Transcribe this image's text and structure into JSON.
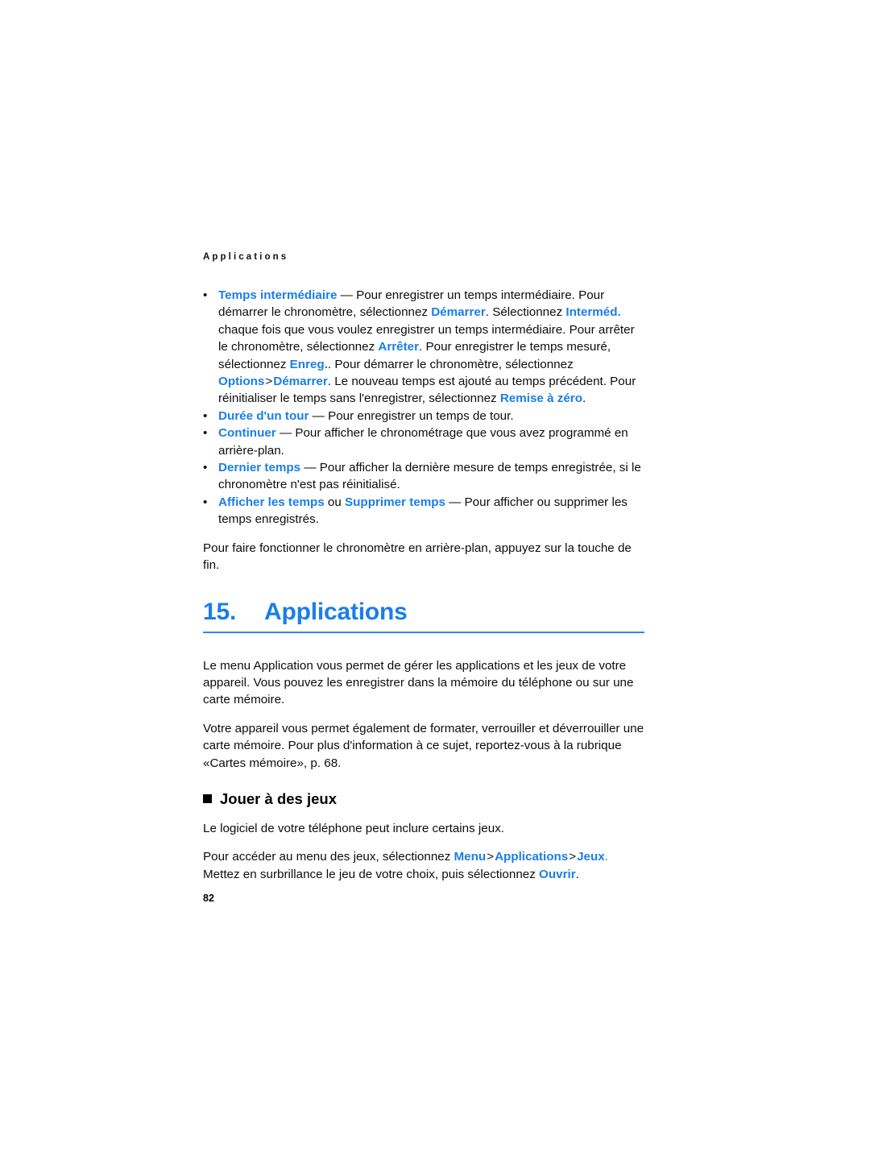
{
  "document": {
    "running_header": "Applications",
    "page_number": "82",
    "accent_color": "#1a7ee8",
    "text_color": "#0d0d0d",
    "background_color": "#ffffff"
  },
  "stopwatch_options": {
    "bullet_glyph": "•",
    "items": [
      {
        "id": "temps-intermediaire",
        "segments": [
          {
            "text": "Temps intermédiaire",
            "style": "blue"
          },
          {
            "text": " — Pour enregistrer un temps intermédiaire. Pour démarrer le chronomètre, sélectionnez ",
            "style": "plain"
          },
          {
            "text": "Démarrer",
            "style": "blue"
          },
          {
            "text": ". Sélectionnez ",
            "style": "plain"
          },
          {
            "text": "Interméd.",
            "style": "blue"
          },
          {
            "text": " chaque fois que vous voulez enregistrer un temps intermédiaire. Pour arrêter le chronomètre, sélectionnez ",
            "style": "plain"
          },
          {
            "text": "Arrêter",
            "style": "blue"
          },
          {
            "text": ". Pour enregistrer le temps mesuré, sélectionnez ",
            "style": "plain"
          },
          {
            "text": "Enreg.",
            "style": "blue"
          },
          {
            "text": ". Pour démarrer le chronomètre, sélectionnez ",
            "style": "plain"
          },
          {
            "text": "Options",
            "style": "blue"
          },
          {
            "text": ">",
            "style": "sep"
          },
          {
            "text": "Démarrer",
            "style": "blue"
          },
          {
            "text": ". Le nouveau temps est ajouté au temps précédent. Pour réinitialiser le temps sans l'enregistrer, sélectionnez ",
            "style": "plain"
          },
          {
            "text": "Remise à zéro",
            "style": "blue"
          },
          {
            "text": ".",
            "style": "plain"
          }
        ]
      },
      {
        "id": "duree-dun-tour",
        "segments": [
          {
            "text": "Durée d'un tour",
            "style": "blue"
          },
          {
            "text": " — Pour enregistrer un temps de tour.",
            "style": "plain"
          }
        ]
      },
      {
        "id": "continuer",
        "segments": [
          {
            "text": "Continuer",
            "style": "blue"
          },
          {
            "text": " — Pour afficher le chronométrage que vous avez programmé en arrière-plan.",
            "style": "plain"
          }
        ]
      },
      {
        "id": "dernier-temps",
        "segments": [
          {
            "text": "Dernier temps",
            "style": "blue"
          },
          {
            "text": " — Pour afficher la dernière mesure de temps enregistrée, si le chronomètre n'est pas réinitialisé.",
            "style": "plain"
          }
        ]
      },
      {
        "id": "afficher-supprimer-temps",
        "segments": [
          {
            "text": "Afficher les temps",
            "style": "blue"
          },
          {
            "text": " ou ",
            "style": "plain"
          },
          {
            "text": "Supprimer temps",
            "style": "blue"
          },
          {
            "text": " — Pour afficher ou supprimer les temps enregistrés.",
            "style": "plain"
          }
        ]
      }
    ],
    "closing_paragraph": "Pour faire fonctionner le chronomètre en arrière-plan, appuyez sur la touche de fin."
  },
  "chapter": {
    "number": "15.",
    "title": "Applications",
    "paragraphs": [
      "Le menu Application vous permet de gérer les applications et les jeux de votre appareil. Vous pouvez les enregistrer dans la mémoire du téléphone ou sur une carte mémoire.",
      "Votre appareil vous permet également de formater, verrouiller et déverrouiller une carte mémoire. Pour plus d'information à ce sujet, reportez-vous à la rubrique «Cartes mémoire», p. 68."
    ]
  },
  "section_games": {
    "heading": "Jouer à des jeux",
    "paragraph_1": "Le logiciel de votre téléphone peut inclure certains jeux.",
    "paragraph_2_segments": [
      {
        "text": "Pour accéder au menu des jeux, sélectionnez ",
        "style": "plain"
      },
      {
        "text": "Menu",
        "style": "blue"
      },
      {
        "text": ">",
        "style": "sep"
      },
      {
        "text": "Applications",
        "style": "blue"
      },
      {
        "text": ">",
        "style": "sep"
      },
      {
        "text": "Jeux",
        "style": "blue"
      },
      {
        "text": ".",
        "style": "blue-plain"
      },
      {
        "text": " Mettez en surbrillance le jeu de votre choix, puis sélectionnez ",
        "style": "plain"
      },
      {
        "text": "Ouvrir",
        "style": "blue"
      },
      {
        "text": ".",
        "style": "plain"
      }
    ]
  }
}
